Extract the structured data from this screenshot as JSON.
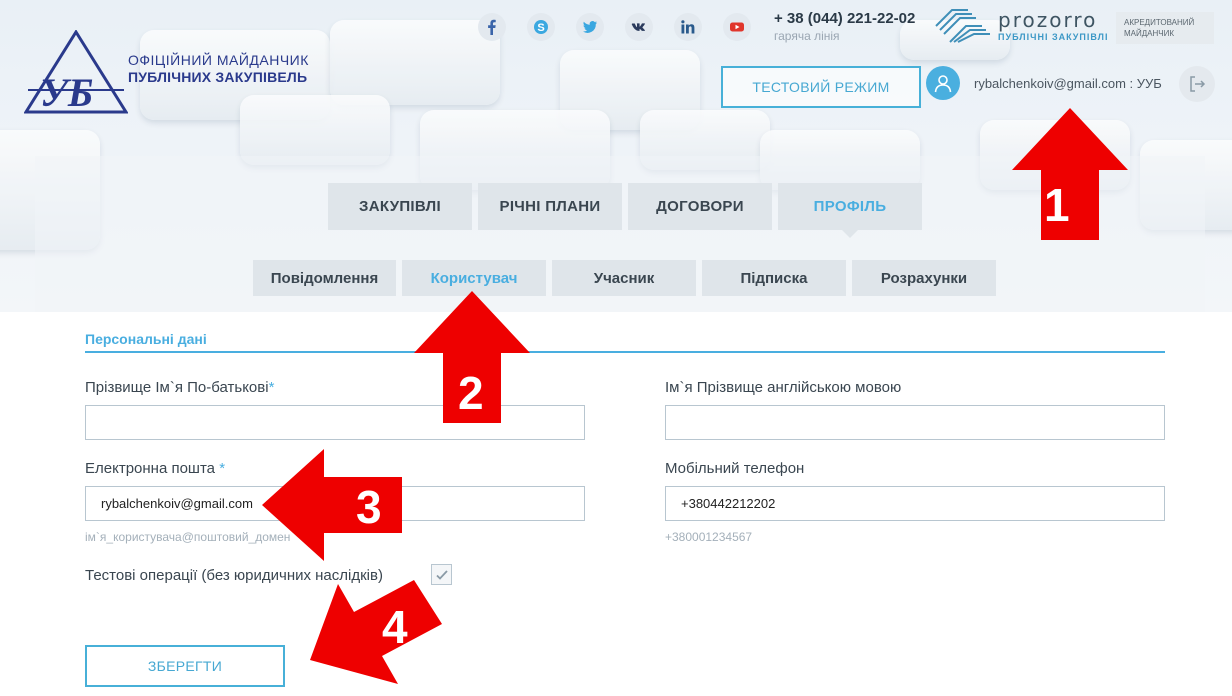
{
  "brand": {
    "line1": "ОФІЦІЙНИЙ МАЙДАНЧИК",
    "line2": "ПУБЛІЧНИХ ЗАКУПІВЕЛЬ"
  },
  "social": [
    "facebook-icon",
    "skype-icon",
    "twitter-icon",
    "vk-icon",
    "linkedin-icon",
    "youtube-icon"
  ],
  "hotline": {
    "phone": "+ 38 (044) 221-22-02",
    "label": "гаряча лінія"
  },
  "prozorro": {
    "name": "prozorro",
    "subtitle": "ПУБЛІЧНІ ЗАКУПІВЛІ",
    "accredited": "АКРЕДИТОВАНИЙ МАЙДАНЧИК"
  },
  "test_mode_label": "ТЕСТОВИЙ РЕЖИМ",
  "user": {
    "email": "rybalchenkoiv@gmail.com : УУБ"
  },
  "main_nav": [
    {
      "label": "ЗАКУПІВЛІ",
      "active": false
    },
    {
      "label": "РІЧНІ ПЛАНИ",
      "active": false
    },
    {
      "label": "ДОГОВОРИ",
      "active": false
    },
    {
      "label": "ПРОФІЛЬ",
      "active": true
    }
  ],
  "sub_nav": [
    {
      "label": "Повідомлення",
      "active": false
    },
    {
      "label": "Користувач",
      "active": true
    },
    {
      "label": "Учасник",
      "active": false
    },
    {
      "label": "Підписка",
      "active": false
    },
    {
      "label": "Розрахунки",
      "active": false
    }
  ],
  "form": {
    "section_title": "Персональні дані",
    "full_name": {
      "label": "Прізвище Ім`я По-батькові",
      "value": ""
    },
    "name_en": {
      "label": "Ім`я Прізвище англійською мовою",
      "value": ""
    },
    "email": {
      "label": "Електронна пошта",
      "value": "rybalchenkoiv@gmail.com",
      "hint": "ім`я_користувача@поштовий_домен"
    },
    "phone": {
      "label": "Мобільний телефон",
      "value": "+380442212202",
      "hint": "+380001234567"
    },
    "test_ops": {
      "label": "Тестові операції (без юридичних наслідків)",
      "checked": true
    },
    "save_label": "ЗБЕРЕГТИ"
  },
  "annotations": [
    "1",
    "2",
    "3",
    "4"
  ],
  "colors": {
    "accent": "#49aee0",
    "arrow": "#ee0000",
    "tab_bg": "#dfe5ea"
  }
}
